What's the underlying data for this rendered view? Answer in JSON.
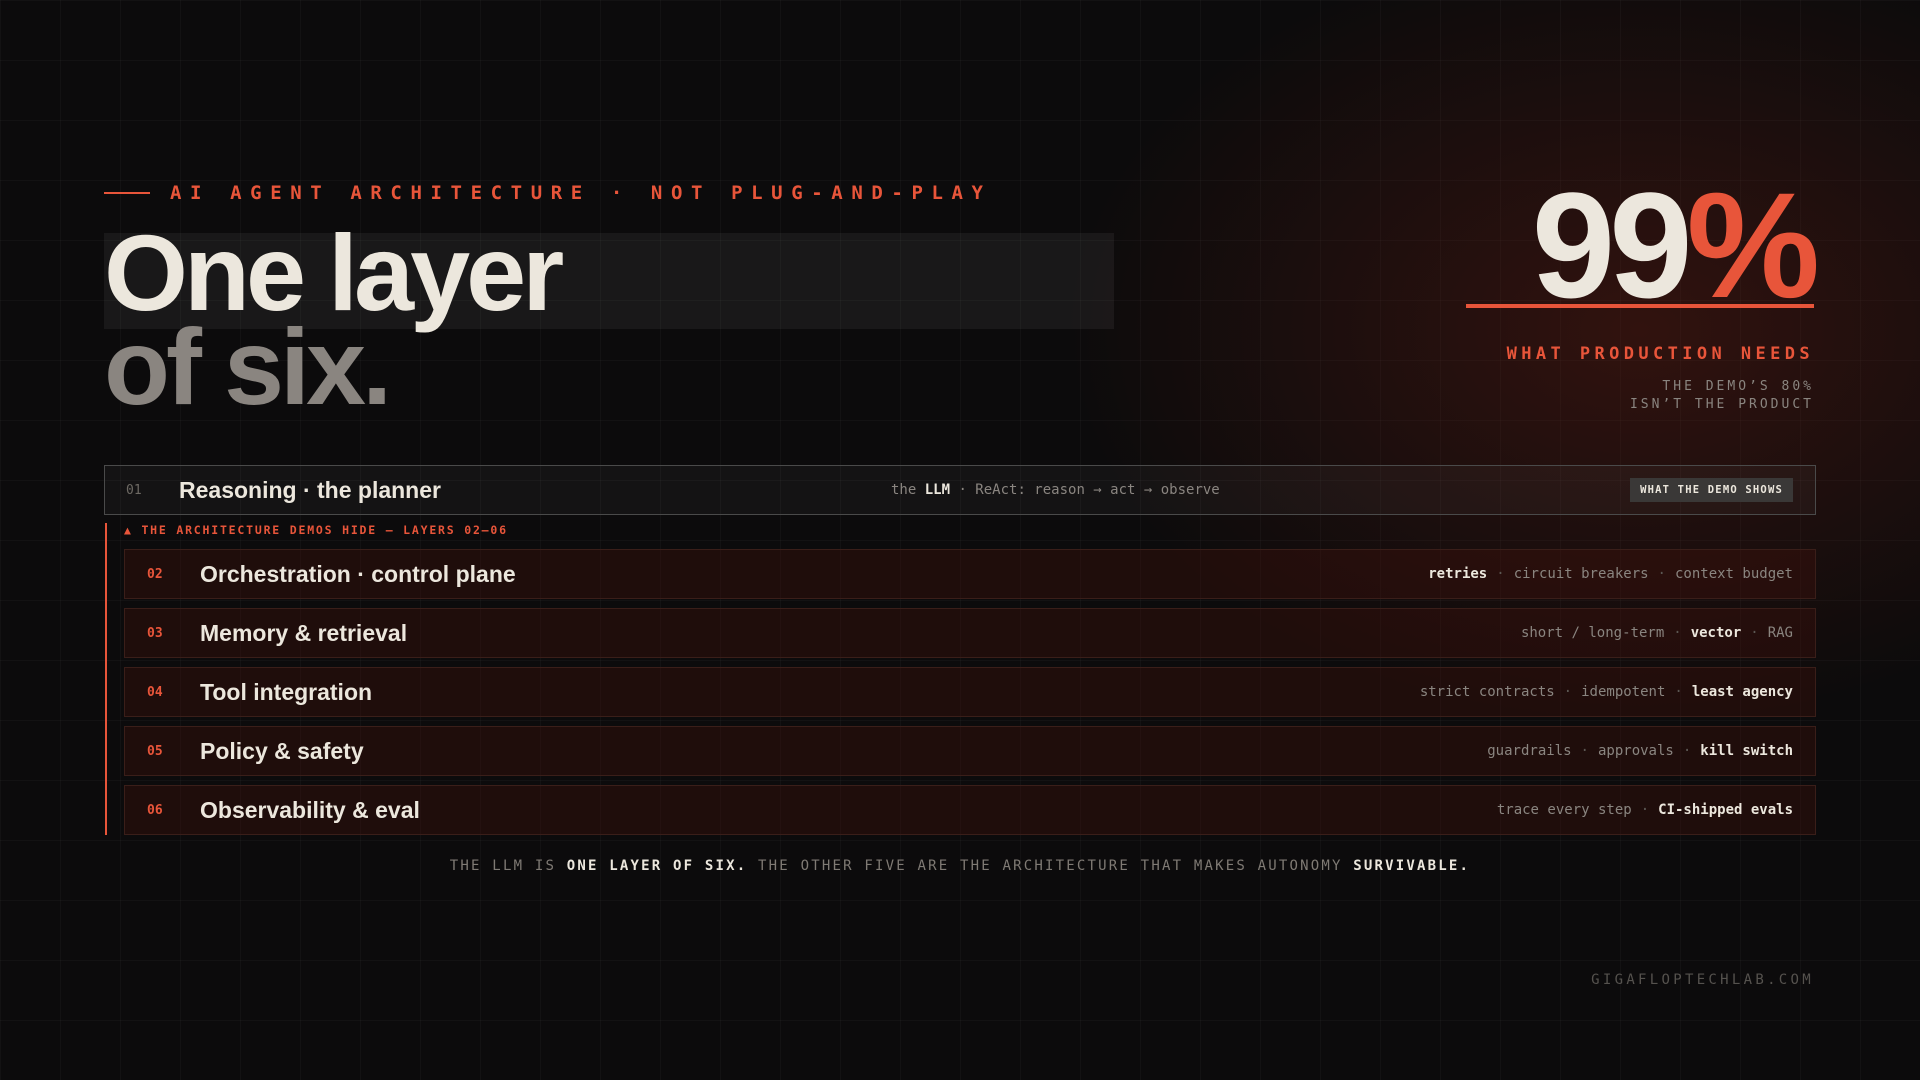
{
  "eyebrow": "AI AGENT ARCHITECTURE · NOT PLUG-AND-PLAY",
  "title": {
    "line1": "One layer",
    "line2": "of six."
  },
  "stat": {
    "number": "99",
    "suffix": "%",
    "label": "WHAT PRODUCTION NEEDS",
    "sub_line1": "THE DEMO’S 80%",
    "sub_line2": "ISN’T THE PRODUCT"
  },
  "demo_layer": {
    "num": "01",
    "name": "Reasoning · the planner",
    "desc_prefix": "the ",
    "desc_strong": "LLM",
    "desc_suffix": " · ReAct: reason → act → observe",
    "badge": "WHAT THE DEMO SHOWS"
  },
  "hidden_label": "▲ THE ARCHITECTURE DEMOS HIDE — LAYERS 02–06",
  "hidden_layers": [
    {
      "num": "02",
      "name": "Orchestration · control plane",
      "tags": [
        {
          "text": "retries",
          "strong": true
        },
        {
          "text": "circuit breakers",
          "strong": false
        },
        {
          "text": "context budget",
          "strong": false
        }
      ]
    },
    {
      "num": "03",
      "name": "Memory & retrieval",
      "tags": [
        {
          "text": "short / long-term",
          "strong": false
        },
        {
          "text": "vector",
          "strong": true
        },
        {
          "text": "RAG",
          "strong": false
        }
      ]
    },
    {
      "num": "04",
      "name": "Tool integration",
      "tags": [
        {
          "text": "strict contracts",
          "strong": false
        },
        {
          "text": "idempotent",
          "strong": false
        },
        {
          "text": "least agency",
          "strong": true
        }
      ]
    },
    {
      "num": "05",
      "name": "Policy & safety",
      "tags": [
        {
          "text": "guardrails",
          "strong": false
        },
        {
          "text": "approvals",
          "strong": false
        },
        {
          "text": "kill switch",
          "strong": true
        }
      ]
    },
    {
      "num": "06",
      "name": "Observability & eval",
      "tags": [
        {
          "text": "trace every step",
          "strong": false
        },
        {
          "text": "CI-shipped evals",
          "strong": true
        }
      ]
    }
  ],
  "footer": {
    "p1": "THE LLM IS ",
    "p1_strong": "ONE LAYER OF SIX.",
    "p2": " THE OTHER FIVE ARE THE ARCHITECTURE THAT MAKES AUTONOMY ",
    "p2_strong": "SURVIVABLE."
  },
  "site": "GIGAFLOPTECHLAB.COM",
  "colors": {
    "accent": "#e8553a",
    "background": "#0c0b0c",
    "text": "#ece7dd",
    "muted": "#8a8580"
  }
}
